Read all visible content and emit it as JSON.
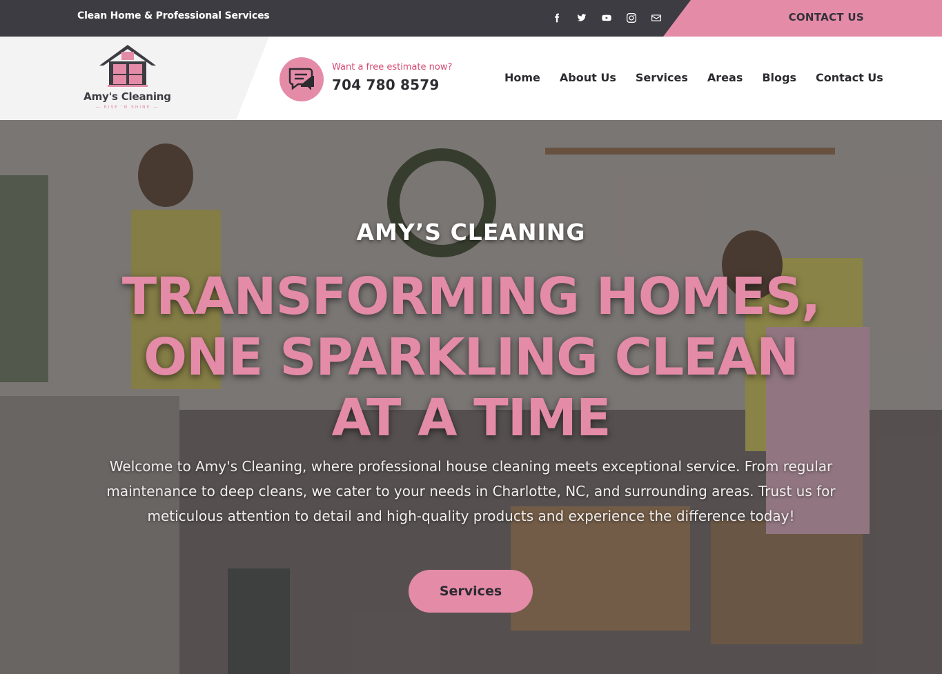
{
  "topbar": {
    "tagline": "Clean Home & Professional Services",
    "social_icons": [
      "facebook-icon",
      "twitter-icon",
      "youtube-icon",
      "instagram-icon",
      "mail-icon"
    ],
    "contact_label": "CONTACT US"
  },
  "brand": {
    "name": "Amy's Cleaning",
    "slogan": "— RISE 'N SHINE —"
  },
  "estimate": {
    "label": "Want a free estimate now?",
    "phone": "704 780 8579"
  },
  "nav": {
    "items": [
      {
        "label": "Home"
      },
      {
        "label": "About Us"
      },
      {
        "label": "Services"
      },
      {
        "label": "Areas"
      },
      {
        "label": "Blogs"
      },
      {
        "label": "Contact Us"
      }
    ]
  },
  "hero": {
    "kicker": "AMY’S CLEANING",
    "headline_line1": "TRANSFORMING HOMES,",
    "headline_line2": "ONE SPARKLING CLEAN",
    "headline_line3": "AT A TIME",
    "intro_line1": "Welcome to Amy's Cleaning, where professional house cleaning meets exceptional service. From regular",
    "intro_line2": "maintenance to deep cleans, we cater to your needs in Charlotte, NC, and surrounding areas. Trust us for",
    "intro_line3": "meticulous attention to detail and high-quality products and experience the difference today!",
    "cta_label": "Services"
  },
  "colors": {
    "accent_pink": "#e48ba8",
    "dark": "#3d3c42",
    "estimate_label": "#d64a73"
  }
}
